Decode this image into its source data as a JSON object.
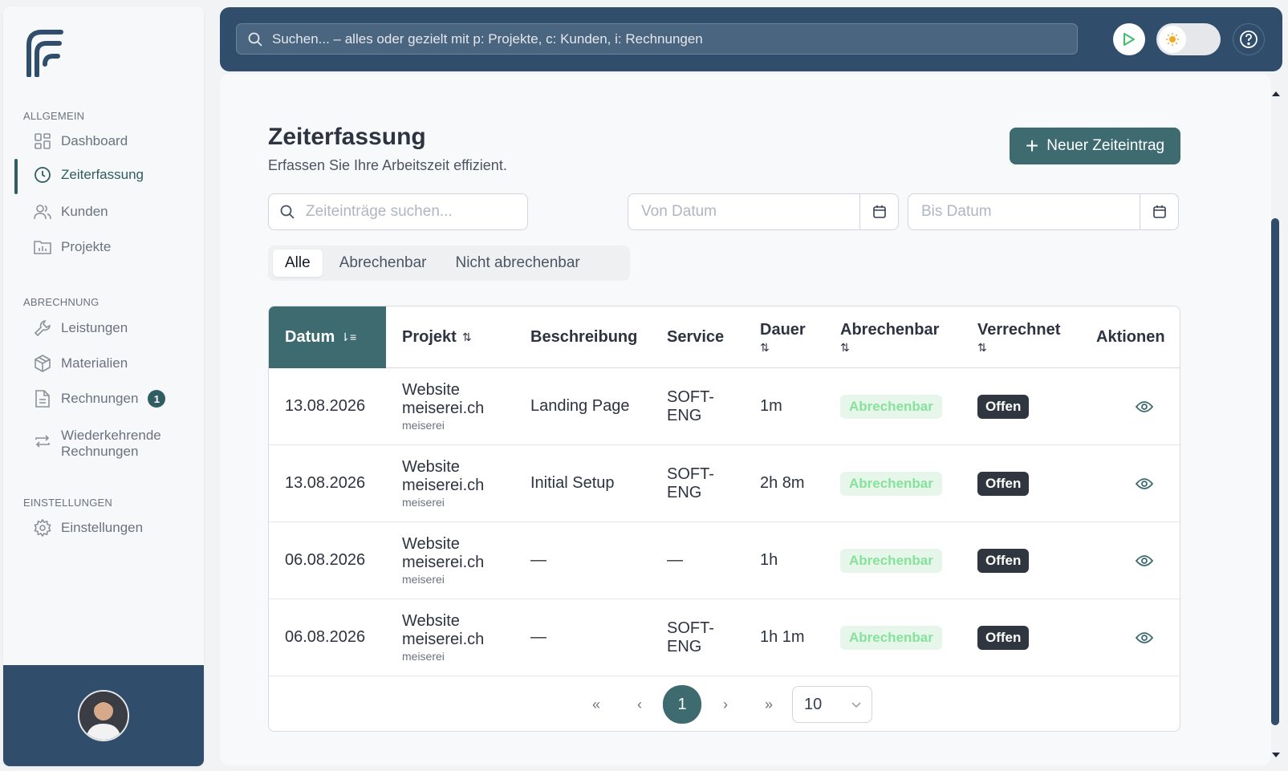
{
  "sidebar": {
    "sections": [
      {
        "label": "ALLGEMEIN"
      },
      {
        "label": "ABRECHNUNG"
      },
      {
        "label": "EINSTELLUNGEN"
      }
    ],
    "items": [
      {
        "label": "Dashboard",
        "icon": "grid-icon"
      },
      {
        "label": "Zeiterfassung",
        "icon": "clock-icon",
        "active": true
      },
      {
        "label": "Kunden",
        "icon": "users-icon"
      },
      {
        "label": "Projekte",
        "icon": "folder-chart-icon"
      },
      {
        "label": "Leistungen",
        "icon": "wrench-icon"
      },
      {
        "label": "Materialien",
        "icon": "package-icon"
      },
      {
        "label": "Rechnungen",
        "icon": "file-text-icon",
        "badge": "1"
      },
      {
        "label_line1": "Wiederkehrende",
        "label_line2": "Rechnungen",
        "icon": "repeat-icon"
      },
      {
        "label": "Einstellungen",
        "icon": "gear-icon"
      }
    ]
  },
  "topbar": {
    "search_placeholder": "Suchen... – alles oder gezielt mit p: Projekte, c: Kunden, i: Rechnungen"
  },
  "page": {
    "title": "Zeiterfassung",
    "subtitle": "Erfassen Sie Ihre Arbeitszeit effizient.",
    "new_button": "Neuer Zeiteintrag",
    "search_placeholder": "Zeiteinträge suchen...",
    "from_placeholder": "Von Datum",
    "to_placeholder": "Bis Datum"
  },
  "filters": {
    "tabs": [
      "Alle",
      "Abrechenbar",
      "Nicht abrechenbar"
    ],
    "active": "Alle"
  },
  "table": {
    "columns": [
      "Datum",
      "Projekt",
      "Beschreibung",
      "Service",
      "Dauer",
      "Abrechenbar",
      "Verrechnet",
      "Aktionen"
    ],
    "rows": [
      {
        "date": "13.08.2026",
        "project_line1": "Website",
        "project_line2": "meiserei.ch",
        "client": "meiserei",
        "description": "Landing Page",
        "service_line1": "SOFT-",
        "service_line2": "ENG",
        "duration": "1m",
        "billable": "Abrechenbar",
        "billed": "Offen"
      },
      {
        "date": "13.08.2026",
        "project_line1": "Website",
        "project_line2": "meiserei.ch",
        "client": "meiserei",
        "description": "Initial Setup",
        "service_line1": "SOFT-",
        "service_line2": "ENG",
        "duration": "2h 8m",
        "billable": "Abrechenbar",
        "billed": "Offen"
      },
      {
        "date": "06.08.2026",
        "project_line1": "Website",
        "project_line2": "meiserei.ch",
        "client": "meiserei",
        "description": "—",
        "service_line1": "—",
        "service_line2": "",
        "duration": "1h",
        "billable": "Abrechenbar",
        "billed": "Offen"
      },
      {
        "date": "06.08.2026",
        "project_line1": "Website",
        "project_line2": "meiserei.ch",
        "client": "meiserei",
        "description": "—",
        "service_line1": "SOFT-",
        "service_line2": "ENG",
        "duration": "1h 1m",
        "billable": "Abrechenbar",
        "billed": "Offen"
      }
    ]
  },
  "pagination": {
    "first": "«",
    "prev": "‹",
    "current": "1",
    "next": "›",
    "last": "»",
    "page_size": "10"
  },
  "colors": {
    "primary": "#304e6b",
    "accent": "#3d6b70",
    "billable_text": "#86e29b",
    "open_badge": "#2f3640"
  }
}
